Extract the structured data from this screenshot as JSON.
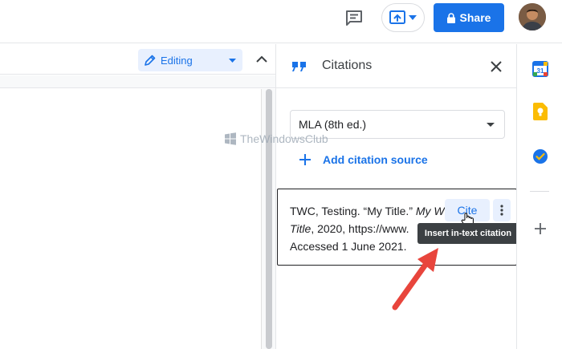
{
  "topbar": {
    "comment_icon": "comment-icon",
    "present_icon": "present-upload-icon",
    "share_label": "Share",
    "share_icon": "lock-icon",
    "avatar_icon": "avatar-icon",
    "accent": "#1a73e8"
  },
  "editor": {
    "mode_label": "Editing",
    "mode_icon": "pencil-icon",
    "collapse_icon": "chevron-up-icon"
  },
  "panel": {
    "title": "Citations",
    "title_icon": "quote-icon",
    "close_icon": "close-icon",
    "style_select": {
      "value": "MLA (8th ed.)"
    },
    "add_source_label": "Add citation source",
    "citation": {
      "line1_prefix": "TWC, Testing. “My Title.” ",
      "line1_italic": "My W",
      "line2_italic": "Title",
      "line2_rest": ", 2020, https://www.",
      "line3": "Accessed 1 June 2021.",
      "cite_label": "Cite",
      "more_icon": "more-vert-icon"
    },
    "tooltip": "Insert in-text citation"
  },
  "rail": {
    "items": [
      "calendar-icon",
      "keep-icon",
      "tasks-icon",
      "add-icon"
    ],
    "calendar_label": "31"
  },
  "watermark": {
    "text": "TheWindowsClub"
  }
}
